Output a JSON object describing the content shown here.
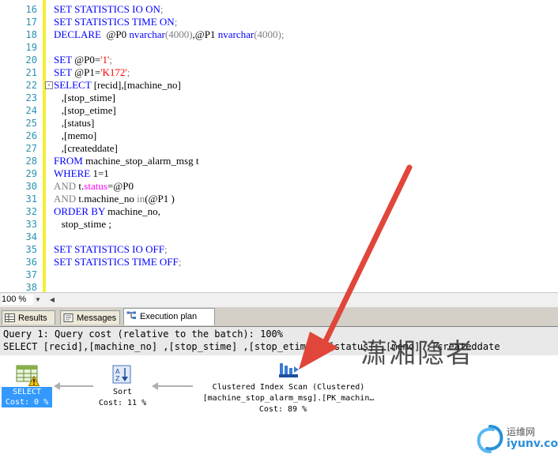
{
  "code_lines": [
    {
      "num": "16",
      "segments": [
        {
          "t": "SET STATISTICS IO ON",
          "c": "kw"
        },
        {
          "t": ";",
          "c": "gray"
        }
      ]
    },
    {
      "num": "17",
      "segments": [
        {
          "t": "SET STATISTICS TIME ON",
          "c": "kw"
        },
        {
          "t": ";",
          "c": "gray"
        }
      ]
    },
    {
      "num": "18",
      "segments": [
        {
          "t": "DECLARE",
          "c": "kw"
        },
        {
          "t": "  @P0 ",
          "c": "plain"
        },
        {
          "t": "nvarchar",
          "c": "kw"
        },
        {
          "t": "(4000)",
          "c": "gray"
        },
        {
          "t": ",@P1 ",
          "c": "plain"
        },
        {
          "t": "nvarchar",
          "c": "kw"
        },
        {
          "t": "(4000);",
          "c": "gray"
        }
      ]
    },
    {
      "num": "19",
      "segments": []
    },
    {
      "num": "20",
      "segments": [
        {
          "t": "SET",
          "c": "kw"
        },
        {
          "t": " @P0=",
          "c": "plain"
        },
        {
          "t": "'1'",
          "c": "str"
        },
        {
          "t": ";",
          "c": "gray"
        }
      ]
    },
    {
      "num": "21",
      "segments": [
        {
          "t": "SET",
          "c": "kw"
        },
        {
          "t": " @P1=",
          "c": "plain"
        },
        {
          "t": "'K172'",
          "c": "str"
        },
        {
          "t": ";",
          "c": "gray"
        }
      ]
    },
    {
      "num": "22",
      "fold": "-",
      "segments": [
        {
          "t": "SELECT",
          "c": "kw"
        },
        {
          "t": " [recid],[machine_no]",
          "c": "plain"
        }
      ]
    },
    {
      "num": "23",
      "segments": [
        {
          "t": "   ,[stop_stime]",
          "c": "plain"
        }
      ]
    },
    {
      "num": "24",
      "segments": [
        {
          "t": "   ,[stop_etime]",
          "c": "plain"
        }
      ]
    },
    {
      "num": "25",
      "segments": [
        {
          "t": "   ,[status]",
          "c": "plain"
        }
      ]
    },
    {
      "num": "26",
      "segments": [
        {
          "t": "   ,[memo]",
          "c": "plain"
        }
      ]
    },
    {
      "num": "27",
      "segments": [
        {
          "t": "   ,[createddate]",
          "c": "plain"
        }
      ]
    },
    {
      "num": "28",
      "segments": [
        {
          "t": "FROM",
          "c": "kw"
        },
        {
          "t": " machine_stop_alarm_msg t",
          "c": "plain"
        }
      ]
    },
    {
      "num": "29",
      "segments": [
        {
          "t": "WHERE",
          "c": "kw"
        },
        {
          "t": " 1=1",
          "c": "plain"
        }
      ]
    },
    {
      "num": "30",
      "segments": [
        {
          "t": "AND",
          "c": "gray"
        },
        {
          "t": " t.",
          "c": "plain"
        },
        {
          "t": "status",
          "c": "fn"
        },
        {
          "t": "=@P0",
          "c": "plain"
        }
      ]
    },
    {
      "num": "31",
      "segments": [
        {
          "t": "AND",
          "c": "gray"
        },
        {
          "t": " t.machine_no ",
          "c": "plain"
        },
        {
          "t": "in",
          "c": "gray"
        },
        {
          "t": "(@P1 )",
          "c": "plain"
        }
      ]
    },
    {
      "num": "32",
      "segments": [
        {
          "t": "ORDER BY",
          "c": "kw"
        },
        {
          "t": " machine_no,",
          "c": "plain"
        }
      ]
    },
    {
      "num": "33",
      "segments": [
        {
          "t": "   stop_stime ;",
          "c": "plain"
        }
      ]
    },
    {
      "num": "34",
      "segments": []
    },
    {
      "num": "35",
      "segments": [
        {
          "t": "SET STATISTICS IO OFF",
          "c": "kw"
        },
        {
          "t": ";",
          "c": "gray"
        }
      ]
    },
    {
      "num": "36",
      "segments": [
        {
          "t": "SET STATISTICS TIME OFF",
          "c": "kw"
        },
        {
          "t": ";",
          "c": "gray"
        }
      ]
    },
    {
      "num": "37",
      "segments": []
    },
    {
      "num": "38",
      "segments": []
    }
  ],
  "zoom": "100 %",
  "tabs": [
    {
      "label": "Results",
      "icon": "grid-icon"
    },
    {
      "label": "Messages",
      "icon": "messages-icon"
    },
    {
      "label": "Execution plan",
      "icon": "execution-plan-icon"
    }
  ],
  "plan": {
    "query_line1": "Query 1: Query cost (relative to the batch): 100%",
    "query_line2": "SELECT [recid],[machine_no] ,[stop_stime] ,[stop_etime] ,[status] ,[memo] ,[createddate",
    "nodes": {
      "select": {
        "title": "SELECT",
        "cost": "Cost: 0 %"
      },
      "sort": {
        "title": "Sort",
        "cost": "Cost: 11 %"
      },
      "scan": {
        "title": "Clustered Index Scan (Clustered)",
        "object": "[machine_stop_alarm_msg].[PK_machin…",
        "cost": "Cost: 89 %"
      }
    }
  },
  "watermark": "潇湘隐者",
  "logo": {
    "text_top": "运维网",
    "text_bottom": "iyunv.com"
  },
  "colors": {
    "keyword": "#0000ff",
    "string": "#ff0000",
    "gray": "#808080",
    "function": "#ff00ff",
    "line_number": "#2b91af",
    "annotation_arrow": "#e0463a",
    "selected_node": "#3399ff"
  }
}
